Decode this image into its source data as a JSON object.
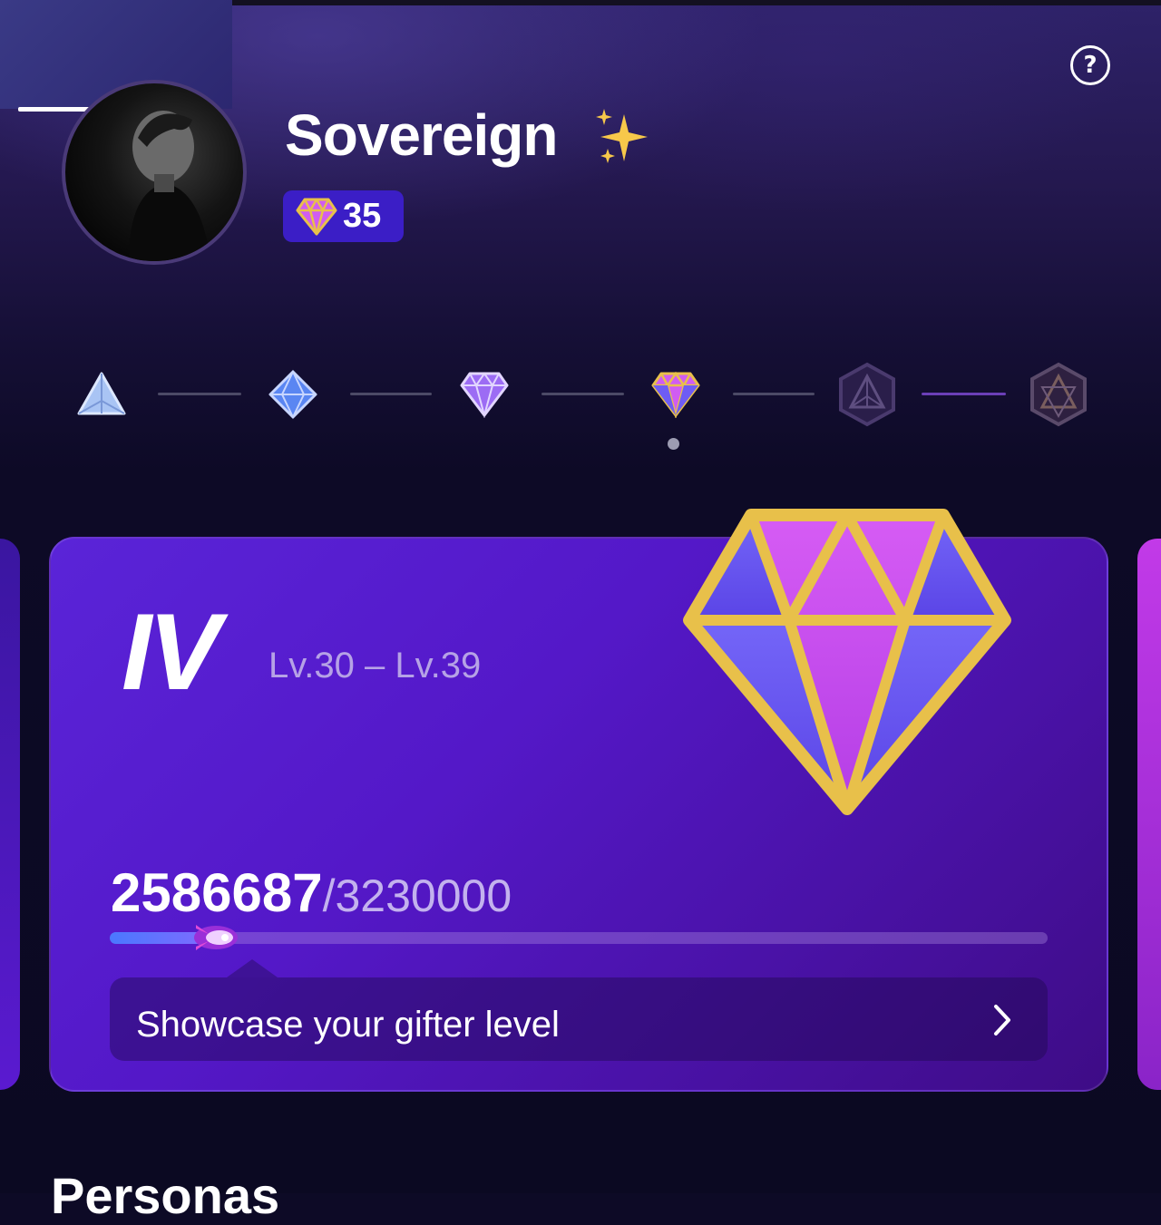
{
  "profile": {
    "name": "Sovereign",
    "name_emoji": "✨",
    "level": "35"
  },
  "help": {
    "icon": "question-mark-icon",
    "glyph": "?"
  },
  "tiers": {
    "items": [
      {
        "icon": "tier-1-pyramid-icon",
        "state": "unlocked"
      },
      {
        "icon": "tier-2-blue-gem-icon",
        "state": "unlocked"
      },
      {
        "icon": "tier-3-purple-gem-icon",
        "state": "unlocked"
      },
      {
        "icon": "tier-4-gold-gem-icon",
        "state": "current"
      },
      {
        "icon": "tier-5-locked-icon",
        "state": "locked"
      },
      {
        "icon": "tier-6-locked-icon",
        "state": "locked"
      }
    ],
    "selected_index": 3
  },
  "card": {
    "tier_label": "IV",
    "level_range": "Lv.30 – Lv.39",
    "progress_current": "2586687",
    "progress_target": "/3230000",
    "progress_fraction": 0.1,
    "showcase_label": "Showcase your gifter level"
  },
  "next_section": {
    "title": "Personas"
  },
  "colors": {
    "card": "#5418c8",
    "pill": "#3b1ec6",
    "gold": "#e8c04a",
    "gem_pink": "#d05cf2",
    "gem_violet": "#6e5cf4"
  }
}
